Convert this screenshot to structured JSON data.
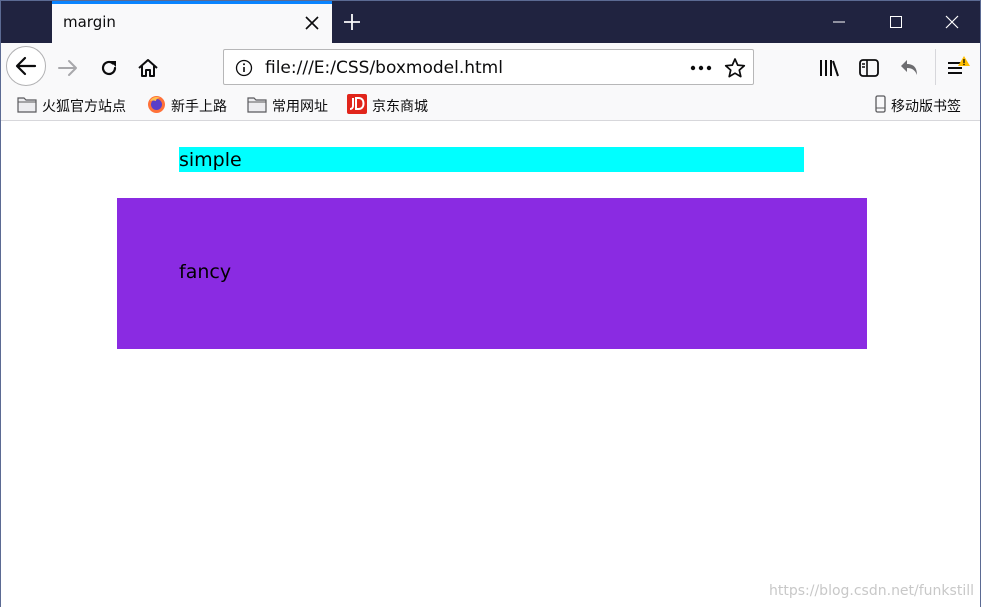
{
  "tab": {
    "title": "margin"
  },
  "urlbar": {
    "url": "file:///E:/CSS/boxmodel.html"
  },
  "bookmarks": {
    "items": [
      {
        "label": "火狐官方站点",
        "icon": "folder-icon"
      },
      {
        "label": "新手上路",
        "icon": "firefox-icon"
      },
      {
        "label": "常用网址",
        "icon": "folder-icon"
      },
      {
        "label": "京东商城",
        "icon": "jd-icon"
      }
    ],
    "mobile": {
      "label": "移动版书签",
      "icon": "mobile-icon"
    }
  },
  "page": {
    "simple_text": "simple",
    "fancy_text": "fancy",
    "simple_color": "#00ffff",
    "fancy_color": "#8a2be2"
  },
  "watermark": "https://blog.csdn.net/funkstill",
  "colors": {
    "titlebar": "#202340",
    "tab_accent": "#0a84ff",
    "warning": "#ffbf00"
  }
}
